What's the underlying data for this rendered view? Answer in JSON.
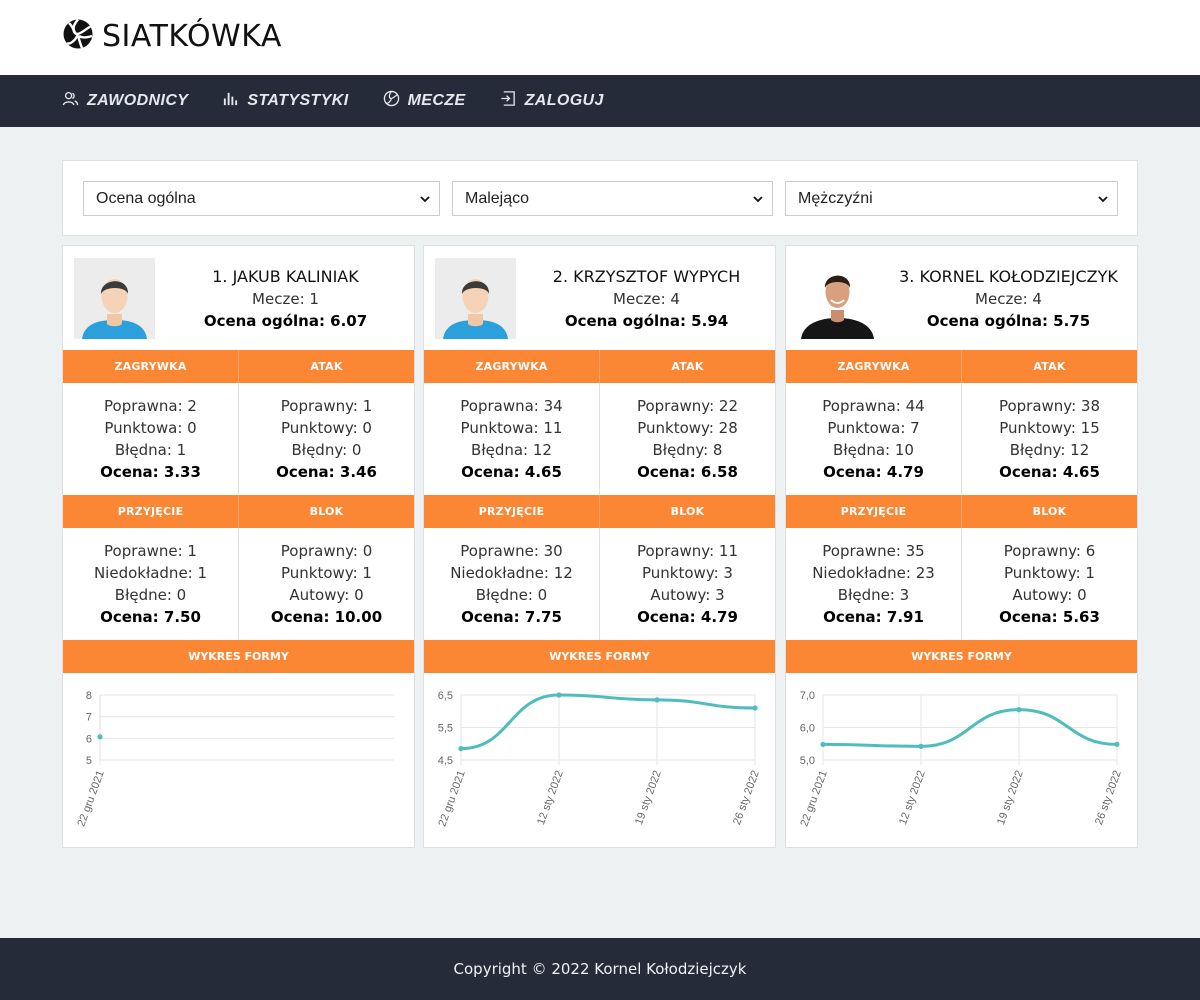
{
  "app": {
    "title": "SIATKÓWKA",
    "logo_icon": "volleyball-icon"
  },
  "nav": [
    {
      "label": "ZAWODNICY",
      "icon": "players-icon"
    },
    {
      "label": "STATYSTYKI",
      "icon": "bar-chart-icon"
    },
    {
      "label": "MECZE",
      "icon": "volleyball-icon"
    },
    {
      "label": "ZALOGUJ",
      "icon": "login-icon"
    }
  ],
  "filters": {
    "sort_by": "Ocena ogólna",
    "order": "Malejąco",
    "gender": "Mężczyźni"
  },
  "players": [
    {
      "name": "1. JAKUB KALINIAK",
      "matches": "Mecze: 1",
      "rating": "Ocena ogólna: 6.07",
      "avatar": "default-avatar",
      "sections": [
        {
          "left_title": "ZAGRYWKA",
          "right_title": "ATAK",
          "left": [
            "Poprawna: 2",
            "Punktowa: 0",
            "Błędna: 1"
          ],
          "left_rating": "Ocena: 3.33",
          "right": [
            "Poprawny: 1",
            "Punktowy: 0",
            "Błędny: 0"
          ],
          "right_rating": "Ocena: 3.46"
        },
        {
          "left_title": "PRZYJĘCIE",
          "right_title": "BLOK",
          "left": [
            "Poprawne: 1",
            "Niedokładne: 1",
            "Błędne: 0"
          ],
          "left_rating": "Ocena: 7.50",
          "right": [
            "Poprawny: 0",
            "Punktowy: 1",
            "Autowy: 0"
          ],
          "right_rating": "Ocena: 10.00"
        }
      ],
      "form_title": "WYKRES FORMY",
      "chart_data": {
        "type": "line",
        "x": [
          "22 gru 2021"
        ],
        "series": [
          {
            "values": [
              6.07
            ]
          }
        ],
        "yticks": [
          "8",
          "7",
          "6",
          "5"
        ],
        "ylim": [
          5,
          8
        ],
        "color": "#4fbdbd",
        "grid": true
      }
    },
    {
      "name": "2. KRZYSZTOF WYPYCH",
      "matches": "Mecze: 4",
      "rating": "Ocena ogólna: 5.94",
      "avatar": "default-avatar",
      "sections": [
        {
          "left_title": "ZAGRYWKA",
          "right_title": "ATAK",
          "left": [
            "Poprawna: 34",
            "Punktowa: 11",
            "Błędna: 12"
          ],
          "left_rating": "Ocena: 4.65",
          "right": [
            "Poprawny: 22",
            "Punktowy: 28",
            "Błędny: 8"
          ],
          "right_rating": "Ocena: 6.58"
        },
        {
          "left_title": "PRZYJĘCIE",
          "right_title": "BLOK",
          "left": [
            "Poprawne: 30",
            "Niedokładne: 12",
            "Błędne: 0"
          ],
          "left_rating": "Ocena: 7.75",
          "right": [
            "Poprawny: 11",
            "Punktowy: 3",
            "Autowy: 3"
          ],
          "right_rating": "Ocena: 4.79"
        }
      ],
      "form_title": "WYKRES FORMY",
      "chart_data": {
        "type": "line",
        "x": [
          "22 gru 2021",
          "12 sty 2022",
          "19 sty 2022",
          "26 sty 2022"
        ],
        "series": [
          {
            "values": [
              4.85,
              6.5,
              6.35,
              6.1
            ]
          }
        ],
        "yticks": [
          "6,5",
          "5,5",
          "4,5"
        ],
        "ylim": [
          4.5,
          6.5
        ],
        "color": "#4fbdbd",
        "grid": true
      }
    },
    {
      "name": "3. KORNEL KOŁODZIEJCZYK",
      "matches": "Mecze: 4",
      "rating": "Ocena ogólna: 5.75",
      "avatar": "player-photo",
      "sections": [
        {
          "left_title": "ZAGRYWKA",
          "right_title": "ATAK",
          "left": [
            "Poprawna: 44",
            "Punktowa: 7",
            "Błędna: 10"
          ],
          "left_rating": "Ocena: 4.79",
          "right": [
            "Poprawny: 38",
            "Punktowy: 15",
            "Błędny: 12"
          ],
          "right_rating": "Ocena: 4.65"
        },
        {
          "left_title": "PRZYJĘCIE",
          "right_title": "BLOK",
          "left": [
            "Poprawne: 35",
            "Niedokładne: 23",
            "Błędne: 3"
          ],
          "left_rating": "Ocena: 7.91",
          "right": [
            "Poprawny: 6",
            "Punktowy: 1",
            "Autowy: 0"
          ],
          "right_rating": "Ocena: 5.63"
        }
      ],
      "form_title": "WYKRES FORMY",
      "chart_data": {
        "type": "line",
        "x": [
          "22 gru 2021",
          "12 sty 2022",
          "19 sty 2022",
          "26 sty 2022"
        ],
        "series": [
          {
            "values": [
              5.48,
              5.42,
              6.55,
              5.48
            ]
          }
        ],
        "yticks": [
          "7,0",
          "6,0",
          "5,0"
        ],
        "ylim": [
          5,
          7
        ],
        "color": "#4fbdbd",
        "grid": true
      }
    }
  ],
  "footer": {
    "text": "Copyright © 2022 Kornel Kołodziejczyk"
  }
}
